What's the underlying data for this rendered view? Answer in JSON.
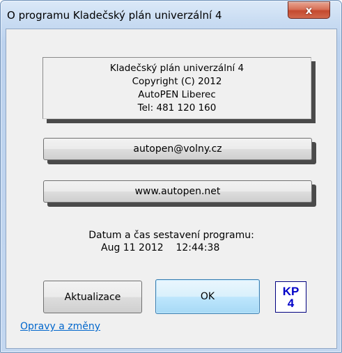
{
  "window": {
    "title": "O programu Kladečský plán univerzální 4",
    "close_glyph": "x"
  },
  "info": {
    "line1": "Kladečský plán univerzální 4",
    "line2": "Copyright (C) 2012",
    "line3": "AutoPEN Liberec",
    "line4": "Tel: 481 120 160"
  },
  "buttons": {
    "email": "autopen@volny.cz",
    "web": "www.autopen.net",
    "update": "Aktualizace",
    "ok": "OK"
  },
  "build": {
    "label": "Datum a čas sestavení programu:",
    "datetime": "Aug 11 2012    12:44:38"
  },
  "logo": {
    "line1": "KP",
    "line2": "4",
    "color": "#0000c8"
  },
  "links": {
    "changes": "Opravy a změny"
  },
  "icons": {
    "close": "close-icon"
  }
}
